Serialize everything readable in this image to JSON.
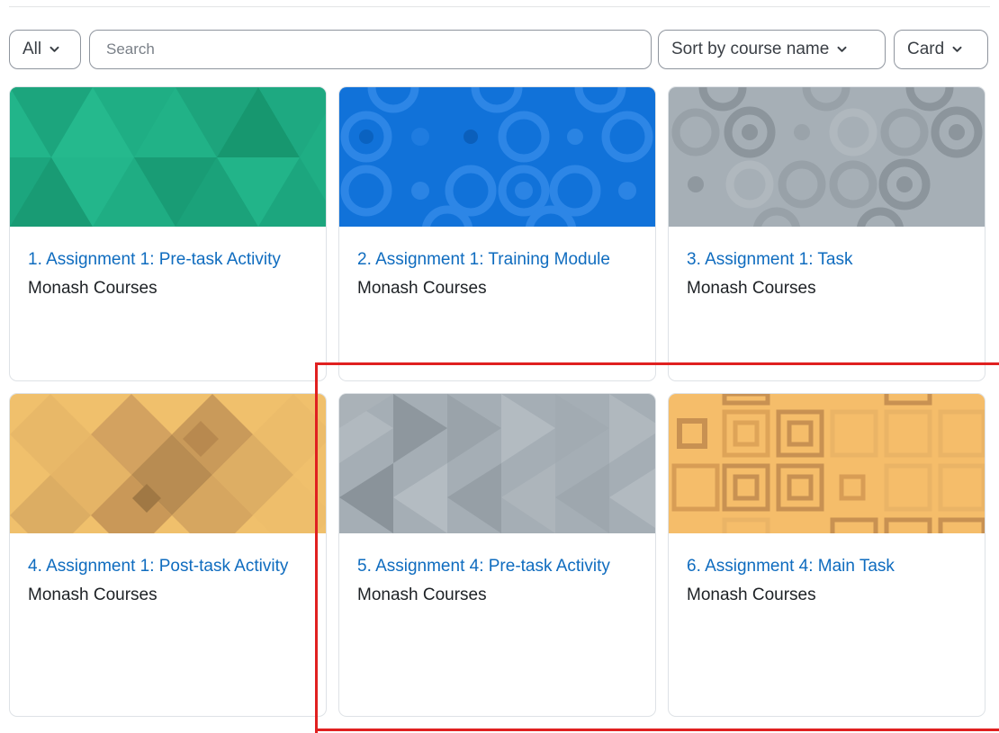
{
  "filter": {
    "label": "All",
    "icon": "chevron-down-icon"
  },
  "search": {
    "placeholder": "Search",
    "value": ""
  },
  "sort": {
    "label": "Sort by course name",
    "icon": "chevron-down-icon"
  },
  "view": {
    "label": "Card",
    "icon": "chevron-down-icon"
  },
  "courses": [
    {
      "title": "1. Assignment 1: Pre-task Activity",
      "category": "Monash Courses",
      "image": "green-triangles"
    },
    {
      "title": "2. Assignment 1: Training Module",
      "category": "Monash Courses",
      "image": "blue-circles"
    },
    {
      "title": "3. Assignment 1: Task",
      "category": "Monash Courses",
      "image": "grey-circles"
    },
    {
      "title": "4. Assignment 1: Post-task Activity",
      "category": "Monash Courses",
      "image": "orange-diamonds"
    },
    {
      "title": "5. Assignment 4: Pre-task Activity",
      "category": "Monash Courses",
      "image": "grey-triangles"
    },
    {
      "title": "6. Assignment 4: Main Task",
      "category": "Monash Courses",
      "image": "orange-squares"
    }
  ],
  "colors": {
    "link": "#0f6cbf",
    "highlight": "#e02020"
  }
}
